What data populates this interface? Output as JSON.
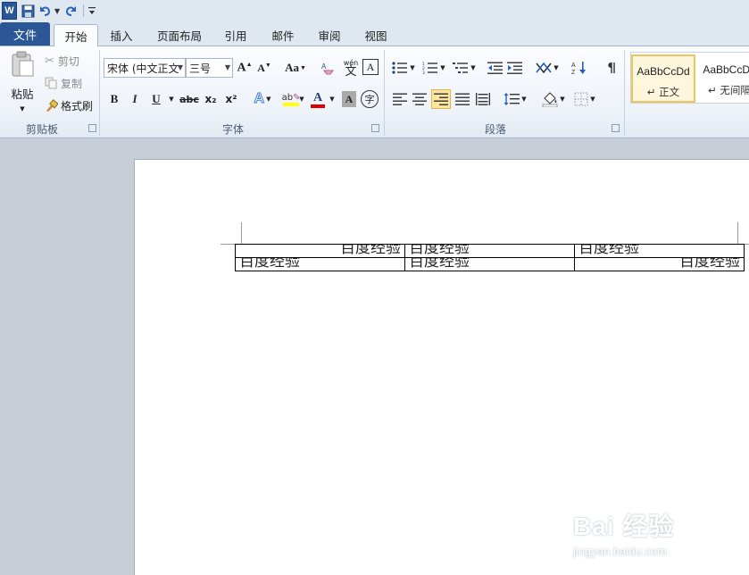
{
  "qat": {
    "app_icon": "W"
  },
  "tabs": {
    "file": "文件",
    "home": "开始",
    "insert": "插入",
    "page_layout": "页面布局",
    "references": "引用",
    "mailings": "邮件",
    "review": "审阅",
    "view": "视图"
  },
  "clipboard": {
    "paste": "粘贴",
    "cut": "剪切",
    "copy": "复制",
    "format_painter": "格式刷",
    "label": "剪贴板"
  },
  "font": {
    "name": "宋体 (中文正文",
    "size": "三号",
    "change_case": "Aa",
    "label": "字体",
    "bold": "B",
    "italic": "I",
    "underline": "U",
    "strike": "abc",
    "subscript": "x₂",
    "superscript": "x²",
    "font_color": "A",
    "char_shading": "A",
    "enclose": "字",
    "phonetic": "wén",
    "phonetic_char": "文"
  },
  "paragraph": {
    "label": "段落"
  },
  "styles": {
    "normal_sample": "AaBbCcDd",
    "normal_name": "↵ 正文",
    "nospacing_sample": "AaBbCcDd",
    "nospacing_name": "↵ 无间隔"
  },
  "document": {
    "rows": [
      [
        {
          "text": "百度经验",
          "align": "right"
        },
        {
          "text": "百度经验",
          "align": "left"
        },
        {
          "text": "百度经验",
          "align": "left"
        }
      ],
      [
        {
          "text": "百度经验",
          "align": "left"
        },
        {
          "text": "百度经验",
          "align": "left"
        },
        {
          "text": "百度经验",
          "align": "right"
        }
      ]
    ]
  },
  "watermark": {
    "brand": "Bai 经验",
    "url": "jingyan.baidu.com"
  },
  "colors": {
    "file_tab": "#2b5797",
    "highlight": "#ffff00",
    "font_red": "#e00000",
    "style_selected": "#f2c55c"
  }
}
